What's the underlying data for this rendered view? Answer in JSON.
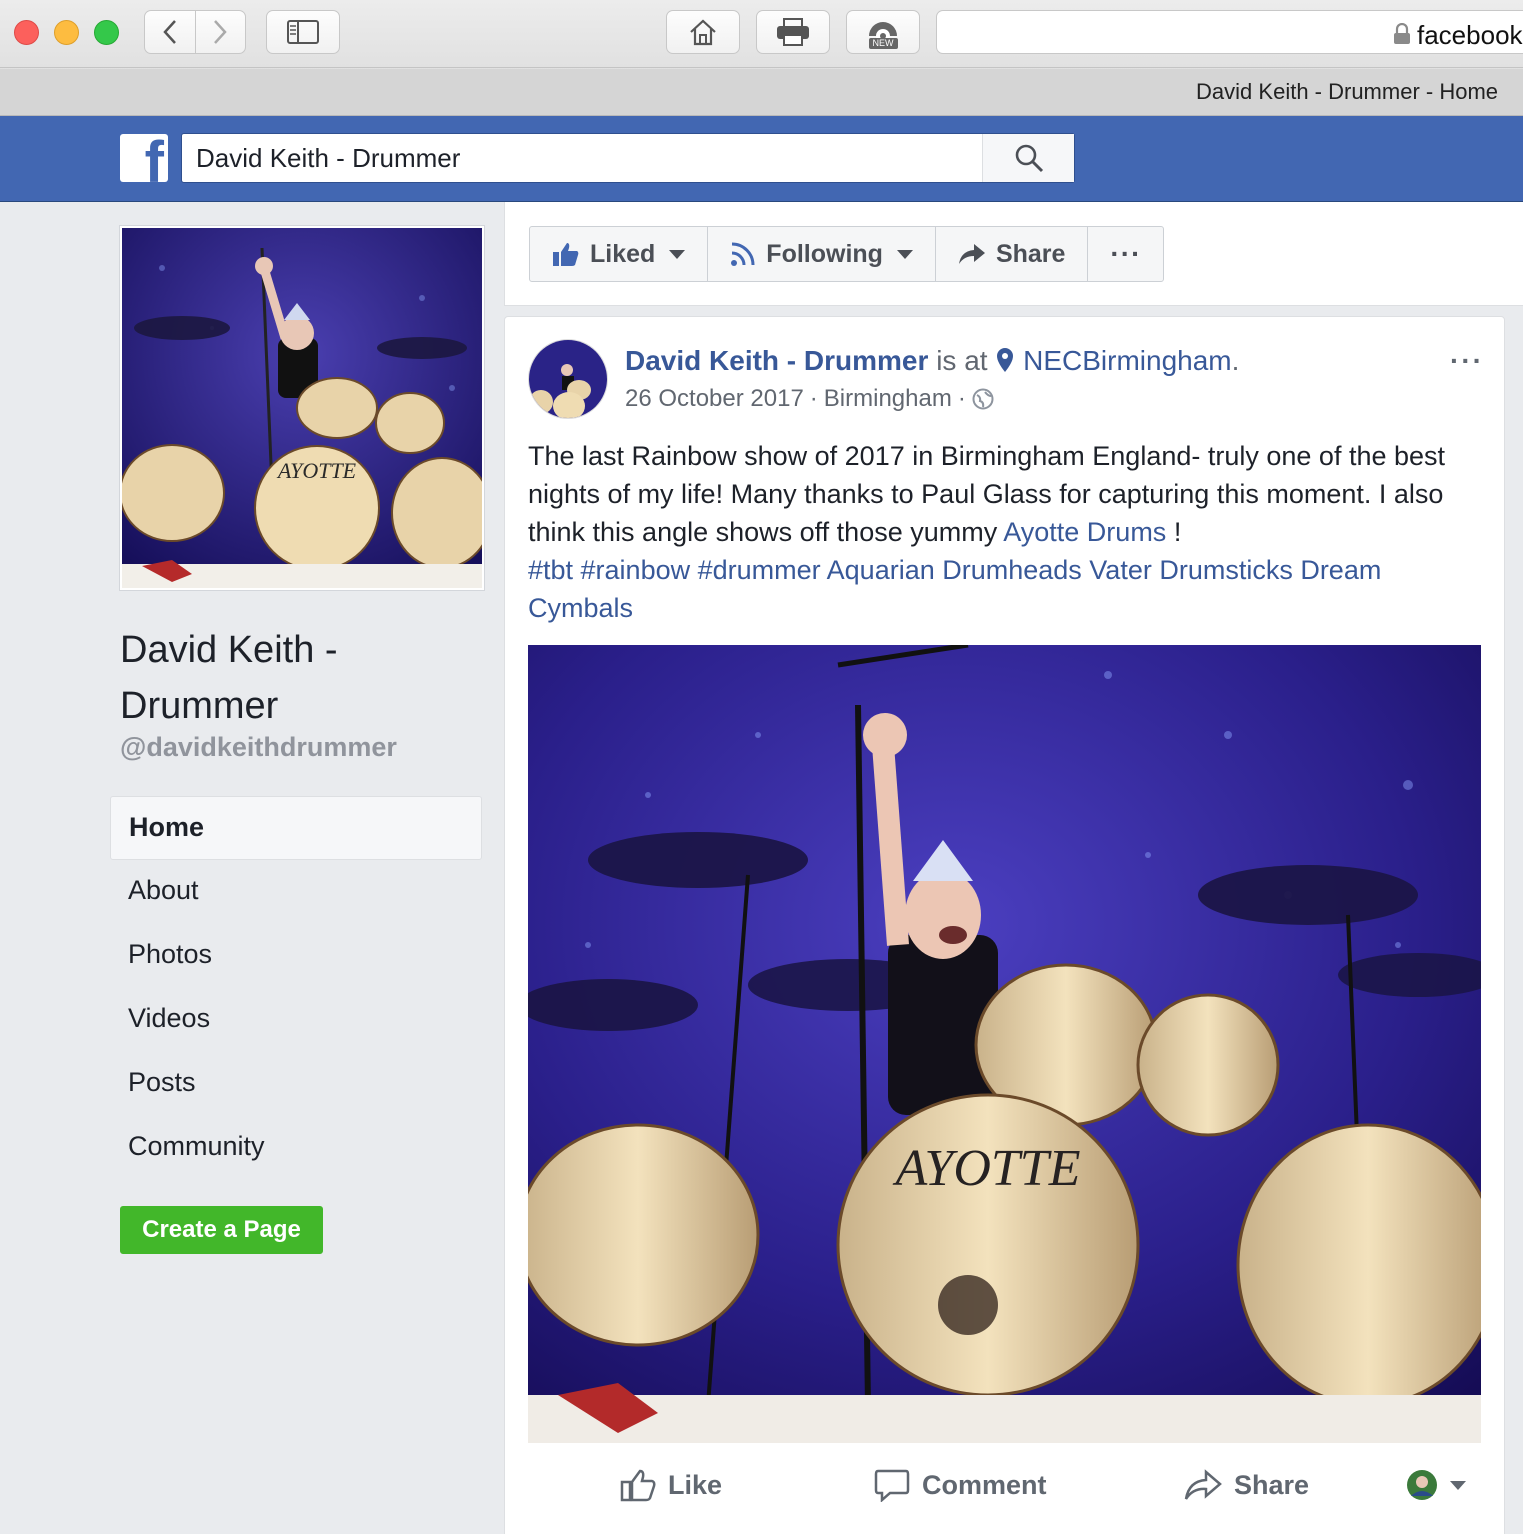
{
  "browser": {
    "url_text": "facebook",
    "tab_title": "David Keith - Drummer - Home",
    "new_badge": "NEW"
  },
  "header": {
    "logo_letter": "f",
    "search_value": "David Keith - Drummer"
  },
  "sidebar": {
    "page_name": "David Keith - Drummer",
    "handle": "@davidkeithdrummer",
    "nav": [
      {
        "label": "Home",
        "active": true
      },
      {
        "label": "About"
      },
      {
        "label": "Photos"
      },
      {
        "label": "Videos"
      },
      {
        "label": "Posts"
      },
      {
        "label": "Community"
      }
    ],
    "create_page_label": "Create a Page"
  },
  "actions": {
    "liked_label": "Liked",
    "following_label": "Following",
    "share_label": "Share",
    "more_label": "···"
  },
  "post": {
    "author": "David Keith - Drummer",
    "is_at": "is at",
    "place": "NECBirmingham",
    "date": "26 October 2017",
    "location": "Birmingham",
    "text_1": "The last Rainbow show of 2017 in Birmingham England- truly one of the best nights of my life! Many thanks to Paul Glass for capturing this moment. I also think this angle shows off those yummy",
    "link_ayotte": "Ayotte Drums",
    "text_2": "!",
    "tags": "#tbt #rainbow #drummer Aquarian Drumheads Vater Drumsticks Dream Cymbals",
    "photo_logo": "AYOTTE",
    "like_label": "Like",
    "comment_label": "Comment",
    "share_label": "Share"
  },
  "colors": {
    "fb_blue": "#4267b2",
    "link_blue": "#385898",
    "green": "#42b72a"
  }
}
